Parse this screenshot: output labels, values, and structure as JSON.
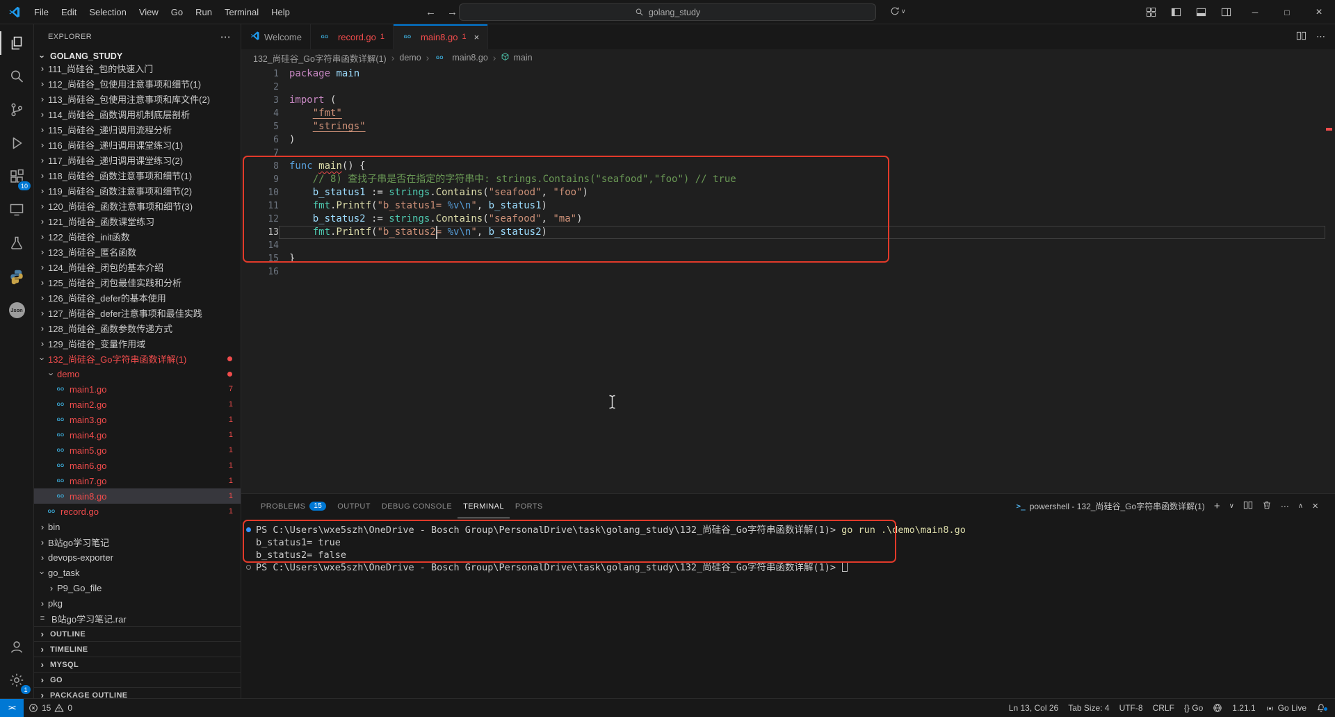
{
  "icons": {
    "chevron": "›",
    "more": "⋯",
    "close": "×",
    "minimize": "─",
    "maximize": "□",
    "plus": "+",
    "chevron_down": "∨",
    "chevron_up": "∧",
    "crumb_sep": "›",
    "back": "←",
    "forward": "→",
    "remote": "><",
    "powershell": ">_",
    "go_badge": "GO",
    "rar": "≡"
  },
  "title_bar": {
    "menus": [
      "File",
      "Edit",
      "Selection",
      "View",
      "Go",
      "Run",
      "Terminal",
      "Help"
    ],
    "search_text": "golang_study"
  },
  "activity_bar": {
    "items": [
      {
        "name": "explorer",
        "active": true
      },
      {
        "name": "search"
      },
      {
        "name": "source-control"
      },
      {
        "name": "run-debug"
      },
      {
        "name": "extensions",
        "badge": "10"
      },
      {
        "name": "remote-explorer"
      },
      {
        "name": "testing"
      },
      {
        "name": "python"
      },
      {
        "name": "json"
      }
    ],
    "bottom": [
      {
        "name": "accounts"
      },
      {
        "name": "settings",
        "badge": "1"
      }
    ]
  },
  "explorer": {
    "title": "EXPLORER",
    "root": "GOLANG_STUDY",
    "tree": [
      {
        "label": "111_尚硅谷_包的快速入门",
        "kind": "folder",
        "level": 1,
        "clip": true
      },
      {
        "label": "112_尚硅谷_包使用注意事项和细节(1)",
        "kind": "folder",
        "level": 1
      },
      {
        "label": "113_尚硅谷_包使用注意事项和库文件(2)",
        "kind": "folder",
        "level": 1
      },
      {
        "label": "114_尚硅谷_函数调用机制底层剖析",
        "kind": "folder",
        "level": 1
      },
      {
        "label": "115_尚硅谷_递归调用流程分析",
        "kind": "folder",
        "level": 1
      },
      {
        "label": "116_尚硅谷_递归调用课堂练习(1)",
        "kind": "folder",
        "level": 1
      },
      {
        "label": "117_尚硅谷_递归调用课堂练习(2)",
        "kind": "folder",
        "level": 1
      },
      {
        "label": "118_尚硅谷_函数注意事项和细节(1)",
        "kind": "folder",
        "level": 1
      },
      {
        "label": "119_尚硅谷_函数注意事项和细节(2)",
        "kind": "folder",
        "level": 1
      },
      {
        "label": "120_尚硅谷_函数注意事项和细节(3)",
        "kind": "folder",
        "level": 1
      },
      {
        "label": "121_尚硅谷_函数课堂练习",
        "kind": "folder",
        "level": 1
      },
      {
        "label": "122_尚硅谷_init函数",
        "kind": "folder",
        "level": 1
      },
      {
        "label": "123_尚硅谷_匿名函数",
        "kind": "folder",
        "level": 1
      },
      {
        "label": "124_尚硅谷_闭包的基本介绍",
        "kind": "folder",
        "level": 1
      },
      {
        "label": "125_尚硅谷_闭包最佳实践和分析",
        "kind": "folder",
        "level": 1
      },
      {
        "label": "126_尚硅谷_defer的基本使用",
        "kind": "folder",
        "level": 1
      },
      {
        "label": "127_尚硅谷_defer注意事项和最佳实践",
        "kind": "folder",
        "level": 1
      },
      {
        "label": "128_尚硅谷_函数参数传递方式",
        "kind": "folder",
        "level": 1
      },
      {
        "label": "129_尚硅谷_变量作用域",
        "kind": "folder",
        "level": 1
      },
      {
        "label": "132_尚硅谷_Go字符串函数详解(1)",
        "kind": "folder",
        "level": 1,
        "expanded": true,
        "error": true,
        "dot": true
      },
      {
        "label": "demo",
        "kind": "folder",
        "level": 2,
        "expanded": true,
        "error": true,
        "dot": true
      },
      {
        "label": "main1.go",
        "kind": "go",
        "level": 3,
        "error": true,
        "badge": "7"
      },
      {
        "label": "main2.go",
        "kind": "go",
        "level": 3,
        "error": true,
        "badge": "1"
      },
      {
        "label": "main3.go",
        "kind": "go",
        "level": 3,
        "error": true,
        "badge": "1"
      },
      {
        "label": "main4.go",
        "kind": "go",
        "level": 3,
        "error": true,
        "badge": "1"
      },
      {
        "label": "main5.go",
        "kind": "go",
        "level": 3,
        "error": true,
        "badge": "1"
      },
      {
        "label": "main6.go",
        "kind": "go",
        "level": 3,
        "error": true,
        "badge": "1"
      },
      {
        "label": "main7.go",
        "kind": "go",
        "level": 3,
        "error": true,
        "badge": "1"
      },
      {
        "label": "main8.go",
        "kind": "go",
        "level": 3,
        "error": true,
        "badge": "1",
        "selected": true
      },
      {
        "label": "record.go",
        "kind": "go",
        "level": 2,
        "error": true,
        "badge": "1"
      },
      {
        "label": "bin",
        "kind": "folder",
        "level": 1
      },
      {
        "label": "B站go学习笔记",
        "kind": "folder",
        "level": 1
      },
      {
        "label": "devops-exporter",
        "kind": "folder",
        "level": 1
      },
      {
        "label": "go_task",
        "kind": "folder",
        "level": 1,
        "expanded": true
      },
      {
        "label": "P9_Go_file",
        "kind": "folder",
        "level": 2
      },
      {
        "label": "pkg",
        "kind": "folder",
        "level": 1
      },
      {
        "label": "B站go学习笔记.rar",
        "kind": "rar",
        "level": 1
      }
    ],
    "sections": [
      "OUTLINE",
      "TIMELINE",
      "MYSQL",
      "GO",
      "PACKAGE OUTLINE"
    ]
  },
  "editor_tabs": [
    {
      "label": "Welcome",
      "icon": "vscode"
    },
    {
      "label": "record.go",
      "icon": "go",
      "badge": "1",
      "error": true
    },
    {
      "label": "main8.go",
      "icon": "go",
      "badge": "1",
      "error": true,
      "active": true,
      "closable": true
    }
  ],
  "breadcrumb": {
    "items": [
      {
        "label": "132_尚硅谷_Go字符串函数详解(1)"
      },
      {
        "label": "demo"
      },
      {
        "label": "main8.go",
        "icon": "go"
      },
      {
        "label": "main",
        "icon": "symbol"
      }
    ]
  },
  "editor": {
    "current_line": 13,
    "lines": [
      {
        "n": 1,
        "tokens": [
          [
            "package",
            "kw"
          ],
          [
            " ",
            ""
          ],
          [
            "main",
            "var"
          ]
        ]
      },
      {
        "n": 2,
        "tokens": []
      },
      {
        "n": 3,
        "tokens": [
          [
            "import",
            "kw"
          ],
          [
            " (",
            "pun"
          ]
        ]
      },
      {
        "n": 4,
        "tokens": [
          [
            "    ",
            ""
          ],
          [
            "\"fmt\"",
            "stru"
          ]
        ]
      },
      {
        "n": 5,
        "tokens": [
          [
            "    ",
            ""
          ],
          [
            "\"strings\"",
            "stru"
          ]
        ]
      },
      {
        "n": 6,
        "tokens": [
          [
            ")",
            "pun"
          ]
        ]
      },
      {
        "n": 7,
        "tokens": []
      },
      {
        "n": 8,
        "tokens": [
          [
            "func",
            "kw2"
          ],
          [
            " ",
            ""
          ],
          [
            "main",
            "fnerr"
          ],
          [
            "() {",
            "pun"
          ]
        ]
      },
      {
        "n": 9,
        "tokens": [
          [
            "    ",
            ""
          ],
          [
            "// 8) 查找子串是否在指定的字符串中: strings.Contains(\"seafood\",\"foo\") // true",
            "cmt"
          ]
        ]
      },
      {
        "n": 10,
        "tokens": [
          [
            "    ",
            ""
          ],
          [
            "b_status1",
            "var"
          ],
          [
            " := ",
            "pun"
          ],
          [
            "strings",
            "ns"
          ],
          [
            ".",
            "pun"
          ],
          [
            "Contains",
            "fn"
          ],
          [
            "(",
            "pun"
          ],
          [
            "\"seafood\"",
            "str"
          ],
          [
            ", ",
            "pun"
          ],
          [
            "\"foo\"",
            "str"
          ],
          [
            ")",
            "pun"
          ]
        ]
      },
      {
        "n": 11,
        "tokens": [
          [
            "    ",
            ""
          ],
          [
            "fmt",
            "ns"
          ],
          [
            ".",
            "pun"
          ],
          [
            "Printf",
            "fn"
          ],
          [
            "(",
            "pun"
          ],
          [
            "\"b_status1= ",
            "str"
          ],
          [
            "%v\\n",
            "esc"
          ],
          [
            "\"",
            "str"
          ],
          [
            ", ",
            "pun"
          ],
          [
            "b_status1",
            "var"
          ],
          [
            ")",
            "pun"
          ]
        ]
      },
      {
        "n": 12,
        "tokens": [
          [
            "    ",
            ""
          ],
          [
            "b_status2",
            "var"
          ],
          [
            " := ",
            "pun"
          ],
          [
            "strings",
            "ns"
          ],
          [
            ".",
            "pun"
          ],
          [
            "Contains",
            "fn"
          ],
          [
            "(",
            "pun"
          ],
          [
            "\"seafood\"",
            "str"
          ],
          [
            ", ",
            "pun"
          ],
          [
            "\"ma\"",
            "str"
          ],
          [
            ")",
            "pun"
          ]
        ]
      },
      {
        "n": 13,
        "tokens": [
          [
            "    ",
            ""
          ],
          [
            "fmt",
            "ns"
          ],
          [
            ".",
            "pun"
          ],
          [
            "Printf",
            "fn"
          ],
          [
            "(",
            "pun"
          ],
          [
            "\"b_status2= ",
            "str"
          ],
          [
            "%v\\n",
            "esc"
          ],
          [
            "\"",
            "str"
          ],
          [
            ", ",
            "pun"
          ],
          [
            "b_status2",
            "var"
          ],
          [
            ")",
            "pun"
          ]
        ]
      },
      {
        "n": 14,
        "tokens": []
      },
      {
        "n": 15,
        "tokens": [
          [
            "}",
            "pun"
          ]
        ]
      },
      {
        "n": 16,
        "tokens": []
      }
    ]
  },
  "panel": {
    "tabs": [
      {
        "label": "PROBLEMS",
        "badge": "15"
      },
      {
        "label": "OUTPUT"
      },
      {
        "label": "DEBUG CONSOLE"
      },
      {
        "label": "TERMINAL",
        "active": true
      },
      {
        "label": "PORTS"
      }
    ],
    "shell_label": "powershell - 132_尚硅谷_Go字符串函数详解(1)",
    "terminal": [
      {
        "deco": "filled",
        "tokens": [
          [
            "PS C:\\Users\\wxe5szh\\OneDrive - Bosch Group\\PersonalDrive\\task\\golang_study\\132_尚硅谷_Go字符串函数详解(1)> ",
            "def"
          ],
          [
            "go run .\\demo\\main8.go",
            "cmd"
          ]
        ]
      },
      {
        "tokens": [
          [
            "b_status1= true",
            "def"
          ]
        ]
      },
      {
        "tokens": [
          [
            "b_status2= false",
            "def"
          ]
        ]
      },
      {
        "deco": "hollow",
        "cursor": true,
        "tokens": [
          [
            "PS C:\\Users\\wxe5szh\\OneDrive - Bosch Group\\PersonalDrive\\task\\golang_study\\132_尚硅谷_Go字符串函数详解(1)> ",
            "def"
          ]
        ]
      }
    ]
  },
  "status_bar": {
    "problems": {
      "errors": "15",
      "warnings": "0"
    },
    "right": [
      {
        "label": "Ln 13, Col 26",
        "name": "cursor-position"
      },
      {
        "label": "Tab Size: 4",
        "name": "indentation"
      },
      {
        "label": "UTF-8",
        "name": "encoding"
      },
      {
        "label": "CRLF",
        "name": "eol"
      },
      {
        "label": "{} Go",
        "name": "language-mode"
      },
      {
        "icon": "globe",
        "name": "browser-preview"
      },
      {
        "label": "1.21.1",
        "name": "go-version"
      },
      {
        "icon": "broadcast",
        "label": "Go Live",
        "name": "go-live"
      },
      {
        "icon": "bell",
        "name": "notifications",
        "dot": true
      }
    ]
  }
}
